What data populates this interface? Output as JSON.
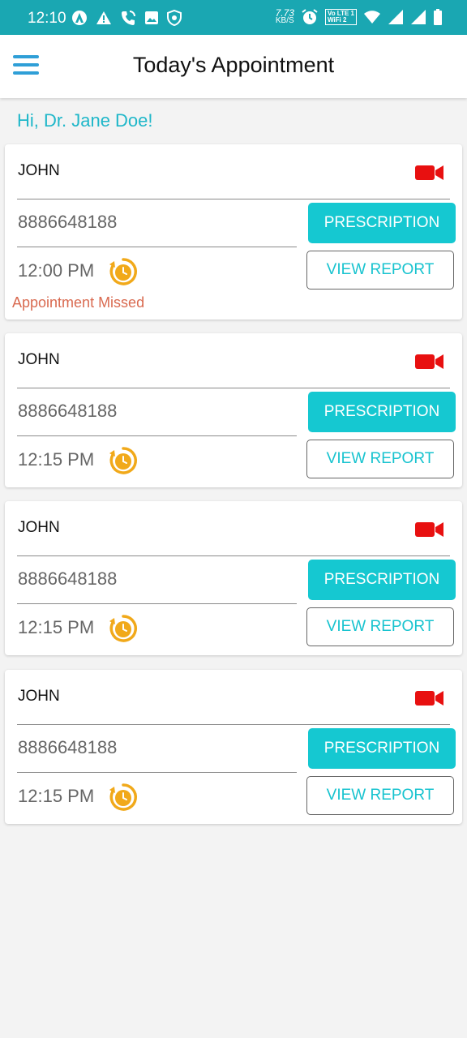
{
  "status_bar": {
    "time": "12:10",
    "net_speed_value": "7.73",
    "net_speed_unit": "KB/S",
    "volte_top": "Vo LTE 1",
    "volte_bottom": "WiFi 2",
    "icons": [
      "arc-icon",
      "warning-icon",
      "wifi-calling-icon",
      "image-icon",
      "shield-icon",
      "alarm-icon",
      "volte-icon",
      "wifi-icon",
      "signal-icon",
      "signal-icon",
      "battery-icon"
    ]
  },
  "app_bar": {
    "title": "Today's Appointment",
    "menu_icon": "hamburger-menu-icon"
  },
  "greeting": "Hi, Dr. Jane Doe!",
  "colors": {
    "accent": "#15c8d1",
    "status_bar": "#1aa7b2",
    "video_icon": "#e81010",
    "clock_icon": "#f1a91a",
    "missed_text": "#d96a50",
    "menu_icon": "#2f9fd7"
  },
  "appointments": [
    {
      "name": "JOHN",
      "phone": "8886648188",
      "time": "12:00 PM",
      "prescription_label": "PRESCRIPTION",
      "report_label": "VIEW REPORT",
      "status": "Appointment Missed"
    },
    {
      "name": "JOHN",
      "phone": "8886648188",
      "time": "12:15 PM",
      "prescription_label": "PRESCRIPTION",
      "report_label": "VIEW REPORT"
    },
    {
      "name": "JOHN",
      "phone": "8886648188",
      "time": "12:15 PM",
      "prescription_label": "PRESCRIPTION",
      "report_label": "VIEW REPORT"
    },
    {
      "name": "JOHN",
      "phone": "8886648188",
      "time": "12:15 PM",
      "prescription_label": "PRESCRIPTION",
      "report_label": "VIEW REPORT"
    }
  ]
}
